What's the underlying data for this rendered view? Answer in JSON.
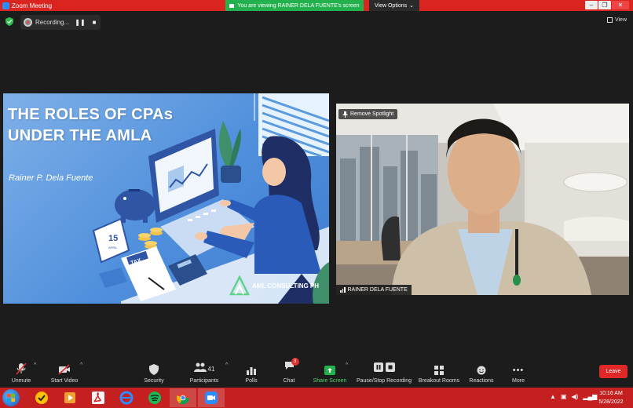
{
  "window": {
    "title": "Zoom Meeting"
  },
  "share_banner": "You are viewing RAINER DELA FUENTE's screen",
  "view_options": "View Options",
  "recording": {
    "label": "Recording...",
    "pause": "❚❚",
    "stop": "■"
  },
  "view_label": "View",
  "slide": {
    "title_line1": "THE ROLES OF CPAs",
    "title_line2": "UNDER THE AMLA",
    "author": "Rainer P. Dela Fuente",
    "brand": "AML CONSULTING PH",
    "calendar_day": "15",
    "calendar_month": "APRIL",
    "tax_label": "TAX"
  },
  "video": {
    "spotlight_label": "Remove Spotlight",
    "participant_name": "RAINER DELA FUENTE"
  },
  "toolbar": {
    "unmute": "Unmute",
    "start_video": "Start Video",
    "security": "Security",
    "participants": "Participants",
    "participants_count": "41",
    "polls": "Polls",
    "chat": "Chat",
    "chat_badge": "3",
    "share_screen": "Share Screen",
    "pause_recording": "Pause/Stop Recording",
    "breakout_rooms": "Breakout Rooms",
    "reactions": "Reactions",
    "more": "More",
    "leave": "Leave"
  },
  "taskbar": {
    "time": "10:16 AM",
    "date": "5/28/2022"
  },
  "colors": {
    "zoom_red": "#d9241f",
    "share_green": "#23b14d",
    "leave_red": "#e02828",
    "slide_blue": "#4f8fdc"
  }
}
